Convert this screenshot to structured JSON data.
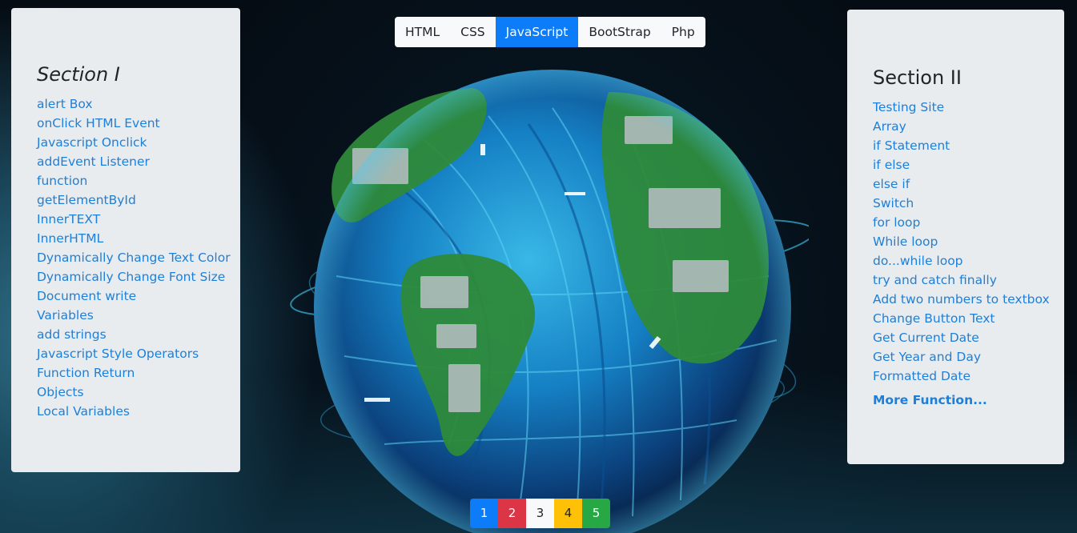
{
  "nav": {
    "tabs": [
      {
        "label": "HTML",
        "active": false
      },
      {
        "label": "CSS",
        "active": false
      },
      {
        "label": "JavaScript",
        "active": true
      },
      {
        "label": "BootStrap",
        "active": false
      },
      {
        "label": "Php",
        "active": false
      }
    ],
    "active_color": "#0d7cf8"
  },
  "section1": {
    "title": "Section I",
    "links": [
      "alert Box",
      "onClick HTML Event",
      "Javascript Onclick",
      "addEvent Listener",
      "function",
      "getElementById",
      "InnerTEXT",
      "InnerHTML",
      "Dynamically Change Text Color",
      "Dynamically Change Font Size",
      "Document write",
      "Variables",
      "add strings",
      "Javascript Style Operators",
      "Function Return",
      "Objects",
      "Local Variables"
    ]
  },
  "section2": {
    "title": "Section II",
    "links": [
      "Testing Site",
      "Array",
      "if Statement",
      "if else",
      "else if",
      "Switch",
      "for loop",
      "While loop",
      "do...while loop",
      "try and catch finally",
      "Add two numbers to textbox",
      "Change Button Text",
      "Get Current Date",
      "Get Year and Day",
      "Formatted Date"
    ],
    "more": "More Function..."
  },
  "pagination": [
    {
      "label": "1",
      "bg": "#0d7cf8",
      "fg": "#ffffff"
    },
    {
      "label": "2",
      "bg": "#dc3545",
      "fg": "#ffffff"
    },
    {
      "label": "3",
      "bg": "#f8f9fa",
      "fg": "#212529"
    },
    {
      "label": "4",
      "bg": "#ffc107",
      "fg": "#212529"
    },
    {
      "label": "5",
      "bg": "#28a745",
      "fg": "#ffffff"
    }
  ],
  "background": {
    "image": "globe-of-cables-and-circuits"
  }
}
